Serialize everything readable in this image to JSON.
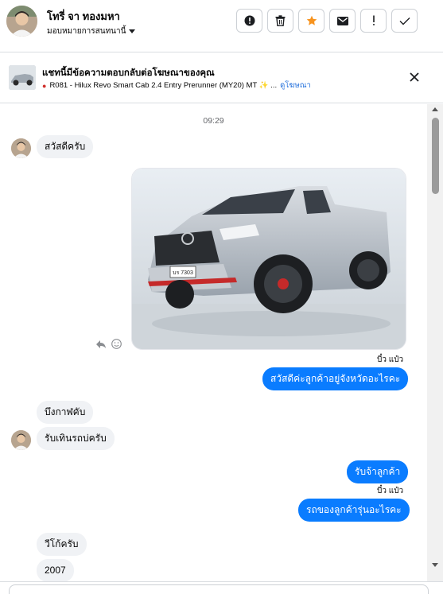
{
  "header": {
    "user_name": "โทรี่ จา ทองมหา",
    "assign_label": "มอบหมายการสนทนานี้",
    "actions": [
      {
        "name": "report-button",
        "icon": "exclamation-circle-icon"
      },
      {
        "name": "delete-button",
        "icon": "trash-icon"
      },
      {
        "name": "star-button",
        "icon": "star-icon"
      },
      {
        "name": "mark-unread-button",
        "icon": "envelope-icon"
      },
      {
        "name": "important-button",
        "icon": "exclamation-icon"
      },
      {
        "name": "done-button",
        "icon": "check-icon"
      }
    ],
    "star_color": "#f7931e"
  },
  "ad": {
    "title": "แชทนี้มีข้อความตอบกลับต่อโฆษณาของคุณ",
    "subtitle": "R081 - Hilux Revo Smart Cab 2.4 Entry Prerunner (MY20) MT ✨ ...",
    "link": "ดูโฆษณา"
  },
  "chat": {
    "timestamp": "09:29",
    "messages": {
      "in1": "สวัสดีครับ",
      "out1": "สวัสดีค่ะลูกค้าอยู่จังหวัดอะไรคะ",
      "in2": "บึงกาฬคับ",
      "in3": "รับเทินรถบ่ครับ",
      "out2": "รับจ้าลูกค้า",
      "out3": "รถของลูกค้ารุ่นอะไรคะ",
      "in4": "วีโก้ครับ",
      "in5": "2007"
    },
    "seen_label": "บี๋ว แป๋ว",
    "plate_text": "บร 7303"
  },
  "colors": {
    "accent": "#0a7cff",
    "link": "#216fdb",
    "incoming_bubble": "#f0f2f5"
  }
}
